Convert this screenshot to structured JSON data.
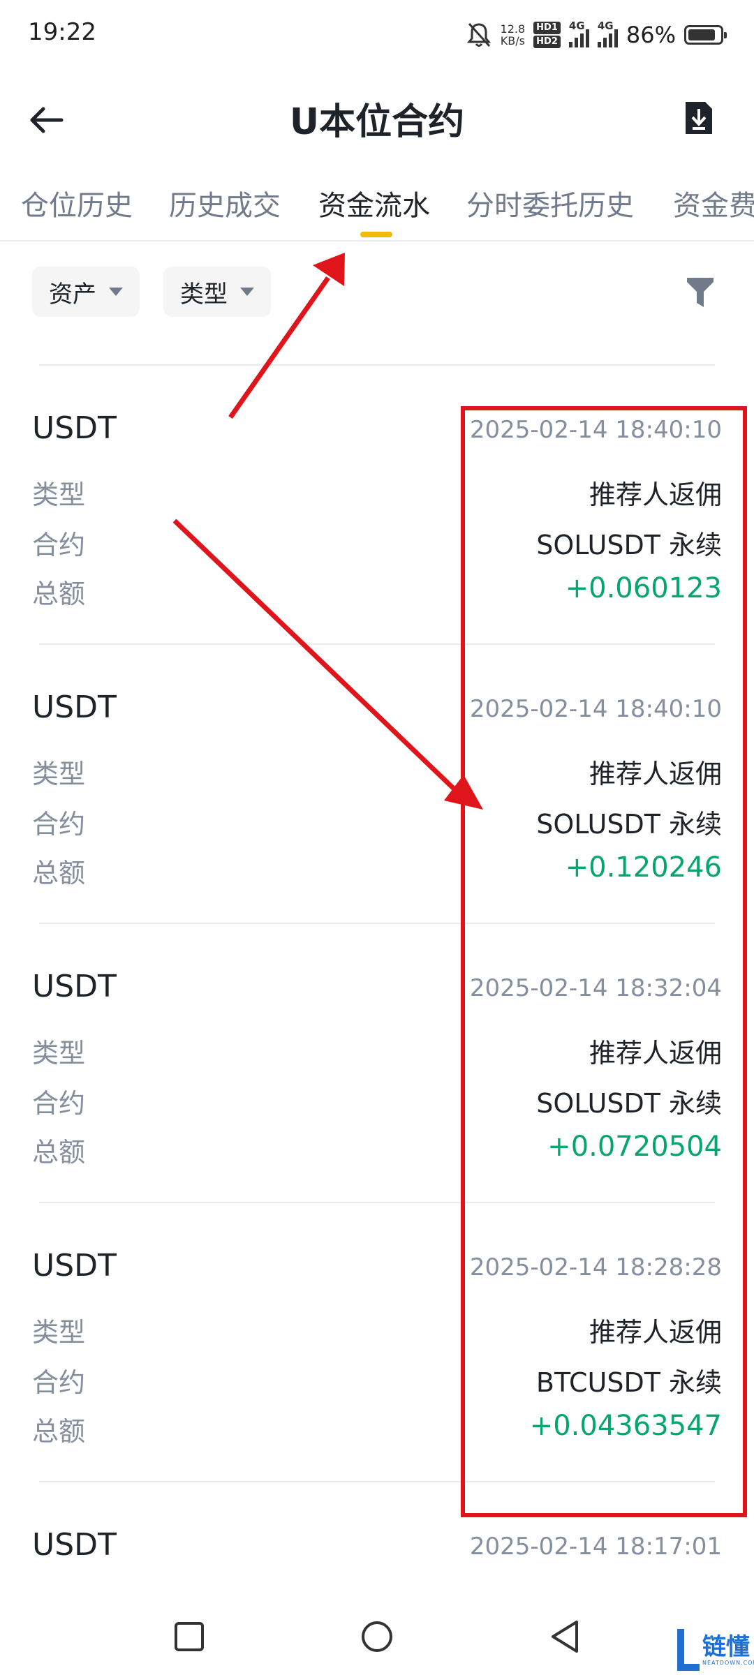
{
  "status_bar": {
    "time": "19:22",
    "net_speed_value": "12.8",
    "net_speed_unit": "KB/s",
    "hd1": "HD1",
    "hd2": "HD2",
    "signal1": "4G",
    "signal2": "4G",
    "battery": "86%",
    "battery_level": 0.86
  },
  "header": {
    "title": "U本位合约"
  },
  "tabs": [
    {
      "label": "仓位历史"
    },
    {
      "label": "历史成交"
    },
    {
      "label": "资金流水"
    },
    {
      "label": "分时委托历史"
    },
    {
      "label": "资金费"
    }
  ],
  "filters": {
    "asset": "资产",
    "type": "类型"
  },
  "labels": {
    "type": "类型",
    "contract": "合约",
    "amount": "总额"
  },
  "records": [
    {
      "asset": "USDT",
      "time": "2025-02-14 18:40:10",
      "type": "推荐人返佣",
      "contract": "SOLUSDT 永续",
      "amount": "+0.060123"
    },
    {
      "asset": "USDT",
      "time": "2025-02-14 18:40:10",
      "type": "推荐人返佣",
      "contract": "SOLUSDT 永续",
      "amount": "+0.120246"
    },
    {
      "asset": "USDT",
      "time": "2025-02-14 18:32:04",
      "type": "推荐人返佣",
      "contract": "SOLUSDT 永续",
      "amount": "+0.0720504"
    },
    {
      "asset": "USDT",
      "time": "2025-02-14 18:28:28",
      "type": "推荐人返佣",
      "contract": "BTCUSDT 永续",
      "amount": "+0.04363547"
    },
    {
      "asset": "USDT",
      "time": "2025-02-14 18:17:01"
    }
  ],
  "watermark": {
    "text": "链懂",
    "sub": "NEATDOWN.COM"
  },
  "colors": {
    "accent": "#f0b90b",
    "positive": "#03a66d",
    "annotation": "#e0141b"
  }
}
